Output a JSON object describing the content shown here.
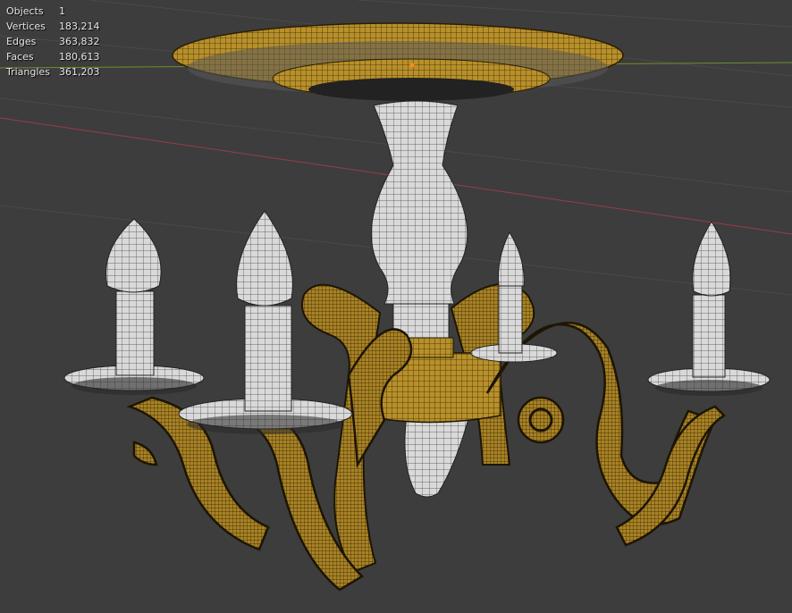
{
  "overlay_stats": [
    {
      "label": "Objects",
      "value": "1"
    },
    {
      "label": "Vertices",
      "value": "183,214"
    },
    {
      "label": "Edges",
      "value": "363,832"
    },
    {
      "label": "Faces",
      "value": "180,613"
    },
    {
      "label": "Triangles",
      "value": "361,203"
    }
  ],
  "colors": {
    "background": "#3d3d3d",
    "grid_line": "#4a4a4a",
    "axis_x": "#9b3b4a",
    "axis_y": "#6d8f2e",
    "origin": "#ff8a1c",
    "gold_face": "#b8902a",
    "gold_wire": "#3a2a08",
    "white_face": "#d9d9d9",
    "white_wire": "#333333"
  }
}
